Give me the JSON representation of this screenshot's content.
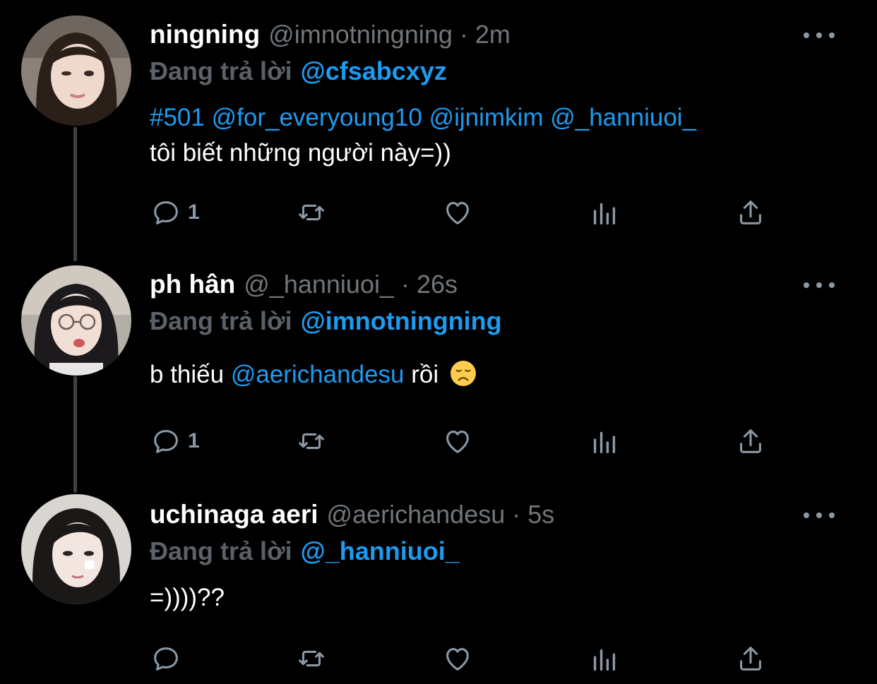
{
  "colors": {
    "background": "#000000",
    "accent": "#1d9bf0",
    "muted": "#71767b",
    "thread_line": "#3d4145",
    "icon": "#8b98a5"
  },
  "tweets": [
    {
      "display_name": "ningning",
      "handle": "@imnotningning",
      "separator": "·",
      "time": "2m",
      "reply_prefix": "Đang trả lời",
      "reply_target": "@cfsabcxyz",
      "text": {
        "line1": {
          "hashtag": "#501",
          "mention1": "@for_everyoung10",
          "mention2": "@ijnimkim",
          "mention3": "@_hanniuoi_"
        },
        "line2": "tôi biết những người này=))"
      },
      "reply_count": "1"
    },
    {
      "display_name": "ph hân",
      "handle": "@_hanniuoi_",
      "separator": "·",
      "time": "26s",
      "reply_prefix": "Đang trả lời",
      "reply_target": "@imnotningning",
      "text": {
        "before": "b thiếu",
        "mention": "@aerichandesu",
        "after": "rồi",
        "emoji": "disappointed-face-emoji"
      },
      "reply_count": "1"
    },
    {
      "display_name": "uchinaga aeri",
      "handle": "@aerichandesu",
      "separator": "·",
      "time": "5s",
      "reply_prefix": "Đang trả lời",
      "reply_target": "@_hanniuoi_",
      "text": {
        "line1": "=))))??"
      },
      "reply_count": ""
    }
  ],
  "actions": [
    "reply-icon",
    "retweet-icon",
    "like-icon",
    "analytics-icon",
    "share-icon"
  ]
}
